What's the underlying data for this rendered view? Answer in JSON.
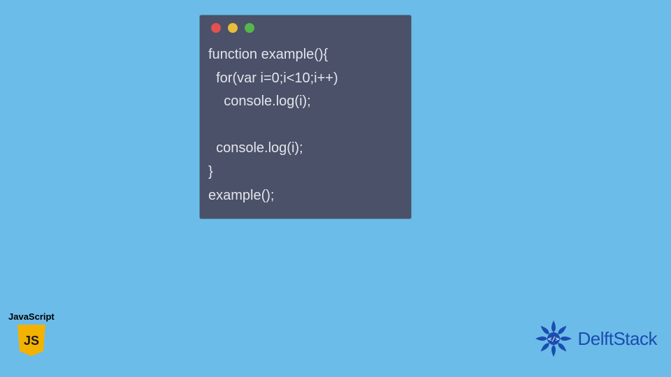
{
  "window": {
    "dots": {
      "red": "#e2504f",
      "yellow": "#e7bd3c",
      "green": "#54b74c"
    }
  },
  "code": {
    "line1": "function example(){",
    "line2": "  for(var i=0;i<10;i++)",
    "line3": "    console.log(i);",
    "line4": "",
    "line5": "  console.log(i);",
    "line6": "}",
    "line7": "example();"
  },
  "badges": {
    "js_label": "JavaScript",
    "js_initials": "JS",
    "brand_name": "DelftStack"
  },
  "colors": {
    "canvas_bg": "#6cbce9",
    "window_bg": "#4a5168",
    "code_text": "#e3e5ec",
    "js_shield": "#f3b200",
    "brand": "#1b4db0"
  }
}
